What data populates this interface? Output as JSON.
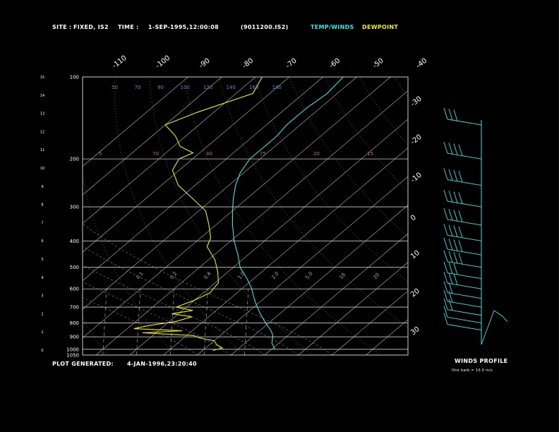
{
  "header": {
    "site_label": "SITE :",
    "site_value": "FIXED, IS2",
    "time_label": "TIME :",
    "time_value": "1-SEP-1995,12:00:08",
    "file_id": "(9011200.IS2)",
    "legend_temp": "TEMP/WINDS",
    "legend_dew": "DEWPOINT"
  },
  "footer": {
    "generated_label": "PLOT GENERATED:",
    "generated_value": "4-JAN-1996,23:20:40",
    "winds_title": "WINDS PROFILE",
    "barb_note": "One barb = 10.0 m/s"
  },
  "colors": {
    "temp": "#33e6e6",
    "dewpoint": "#f0f000",
    "frame": "#cccccc",
    "isotherm": "#bbbbbb",
    "dry_adiabat": "#c87a3a",
    "moist_adiabat": "#8c8c8c",
    "mixing_ratio": "#5a8fd0",
    "wind": "#33e6e6"
  },
  "chart_data": {
    "type": "line",
    "pressure_levels": [
      400,
      200,
      300,
      400,
      500,
      600,
      700,
      800,
      900,
      1000,
      1050
    ],
    "pressure_ticks": [
      {
        "p": 100,
        "label": "100"
      },
      {
        "p": 200,
        "label": "200"
      },
      {
        "p": 300,
        "label": "300"
      },
      {
        "p": 400,
        "label": "400"
      },
      {
        "p": 500,
        "label": "500"
      },
      {
        "p": 600,
        "label": "600"
      },
      {
        "p": 700,
        "label": "700"
      },
      {
        "p": 800,
        "label": "800"
      },
      {
        "p": 900,
        "label": "900"
      },
      {
        "p": 1000,
        "label": "1000"
      },
      {
        "p": 1050,
        "label": "1050"
      }
    ],
    "pressure_top": 100,
    "pressure_bottom": 1050,
    "height_ticks": [
      "0",
      "1",
      "2",
      "3",
      "4",
      "5",
      "6",
      "7",
      "8",
      "9",
      "10",
      "11",
      "12",
      "13",
      "14",
      "15"
    ],
    "isotherm_top_labels": [
      "-110",
      "-100",
      "-90",
      "-80",
      "-70",
      "-60",
      "-50",
      "-40"
    ],
    "isotherm_right_labels": [
      "-30",
      "-20",
      "-10",
      "0",
      "10",
      "20",
      "30"
    ],
    "isotherms": [
      -110,
      -100,
      -90,
      -80,
      -70,
      -60,
      -50,
      -40,
      -30,
      -20,
      -10,
      0,
      10,
      20,
      30,
      40
    ],
    "dry_adiabat_labels": [
      "5",
      "70",
      "40",
      "75",
      "20",
      "15"
    ],
    "mixing_ratio_labels": [
      "0.1",
      "0.2",
      "0.4",
      "1.0",
      "2.0",
      "5.0",
      "10",
      "20"
    ],
    "theta_top_labels": [
      "50",
      "70",
      "90",
      "100",
      "120",
      "140",
      "160",
      "180"
    ],
    "series": [
      {
        "name": "TEMP/WINDS",
        "points": [
          [
            100,
            -64
          ],
          [
            115,
            -63
          ],
          [
            130,
            -64
          ],
          [
            150,
            -64
          ],
          [
            165,
            -63
          ],
          [
            180,
            -63
          ],
          [
            200,
            -63
          ],
          [
            225,
            -61
          ],
          [
            250,
            -58
          ],
          [
            280,
            -54
          ],
          [
            310,
            -50
          ],
          [
            350,
            -45
          ],
          [
            400,
            -39
          ],
          [
            450,
            -33
          ],
          [
            500,
            -28
          ],
          [
            550,
            -22
          ],
          [
            600,
            -17
          ],
          [
            650,
            -13
          ],
          [
            700,
            -9
          ],
          [
            750,
            -5
          ],
          [
            800,
            -1
          ],
          [
            850,
            3
          ],
          [
            880,
            5
          ],
          [
            900,
            6
          ],
          [
            925,
            7
          ],
          [
            950,
            8
          ],
          [
            1000,
            11
          ]
        ]
      },
      {
        "name": "DEWPOINT",
        "points": [
          [
            100,
            -88
          ],
          [
            115,
            -85
          ],
          [
            135,
            -95
          ],
          [
            150,
            -100
          ],
          [
            165,
            -93
          ],
          [
            180,
            -88
          ],
          [
            190,
            -82
          ],
          [
            200,
            -84
          ],
          [
            220,
            -82
          ],
          [
            250,
            -75
          ],
          [
            280,
            -66
          ],
          [
            310,
            -58
          ],
          [
            350,
            -52
          ],
          [
            390,
            -47
          ],
          [
            420,
            -45
          ],
          [
            470,
            -38
          ],
          [
            520,
            -33
          ],
          [
            570,
            -29
          ],
          [
            620,
            -28
          ],
          [
            660,
            -30
          ],
          [
            700,
            -33
          ],
          [
            720,
            -27
          ],
          [
            740,
            -32
          ],
          [
            760,
            -25
          ],
          [
            790,
            -28
          ],
          [
            820,
            -35
          ],
          [
            840,
            -38
          ],
          [
            855,
            -23
          ],
          [
            870,
            -34
          ],
          [
            890,
            -18
          ],
          [
            910,
            -15
          ],
          [
            930,
            -10
          ],
          [
            960,
            -8
          ],
          [
            990,
            -5
          ],
          [
            1010,
            -7
          ]
        ]
      }
    ],
    "winds": [
      {
        "p": 150,
        "spd": 3
      },
      {
        "p": 200,
        "spd": 4
      },
      {
        "p": 250,
        "spd": 4
      },
      {
        "p": 300,
        "spd": 4
      },
      {
        "p": 350,
        "spd": 4
      },
      {
        "p": 400,
        "spd": 4
      },
      {
        "p": 450,
        "spd": 4
      },
      {
        "p": 500,
        "spd": 4
      },
      {
        "p": 550,
        "spd": 3
      },
      {
        "p": 600,
        "spd": 3
      },
      {
        "p": 650,
        "spd": 2
      },
      {
        "p": 700,
        "spd": 2
      },
      {
        "p": 750,
        "spd": 2
      },
      {
        "p": 800,
        "spd": 1
      },
      {
        "p": 850,
        "spd": 1
      }
    ]
  }
}
